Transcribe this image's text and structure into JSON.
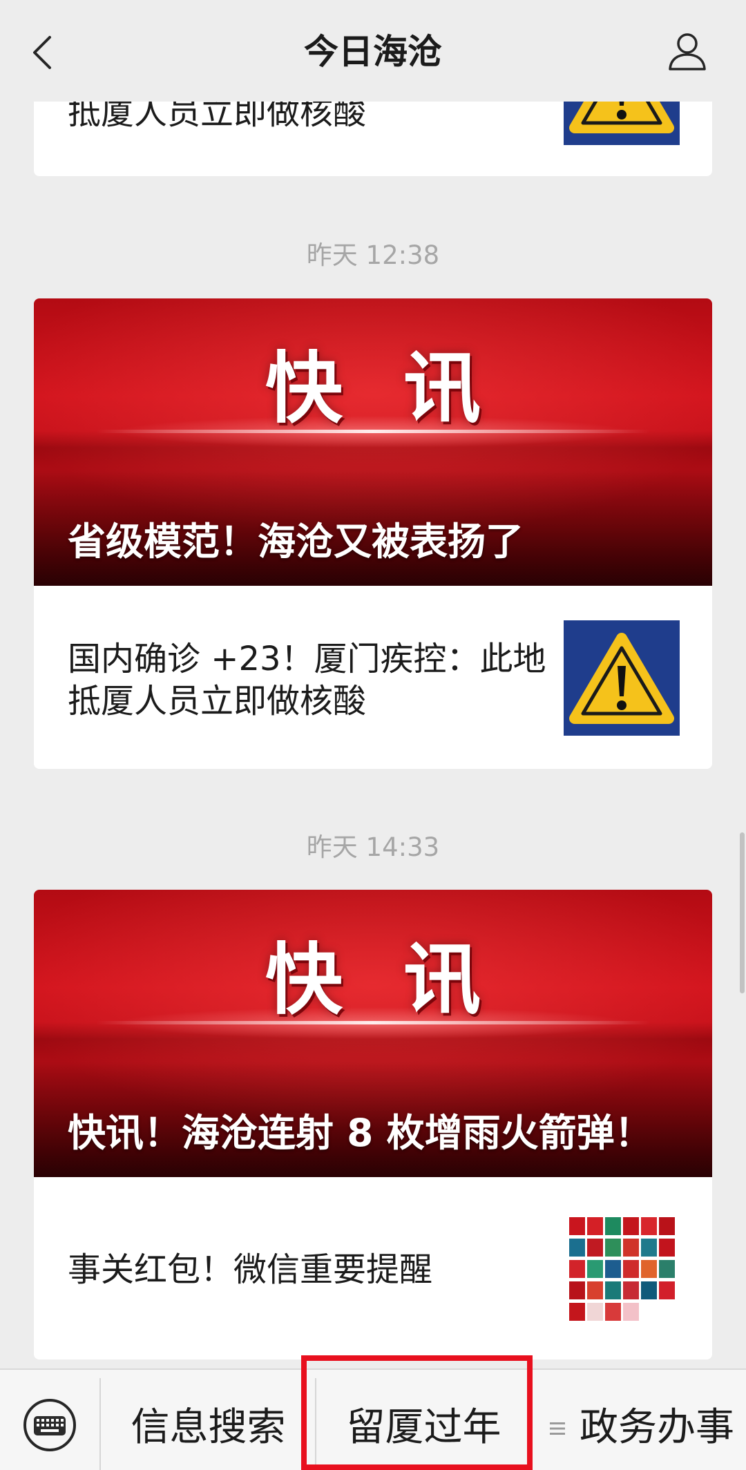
{
  "header": {
    "title": "今日海沧",
    "back_icon": "chevron-left-icon",
    "profile_icon": "person-icon"
  },
  "partial_card": {
    "title_line": "抵厦人员立即做核酸",
    "thumbnail": "warning-sign-icon"
  },
  "messages": [
    {
      "timestamp": "昨天 12:38",
      "banner": {
        "badge": "快讯",
        "title": "省级模范！海沧又被表扬了"
      },
      "item": {
        "lines": [
          "国内确诊 +23！厦门疾控：此地",
          "抵厦人员立即做核酸"
        ],
        "thumbnail": "warning-sign-icon"
      }
    },
    {
      "timestamp": "昨天 14:33",
      "banner": {
        "badge": "快讯",
        "title": "快讯！海沧连射 8 枚增雨火箭弹！"
      },
      "item": {
        "lines": [
          "事关红包！微信重要提醒"
        ],
        "thumbnail": "red-envelopes-image"
      }
    }
  ],
  "menu": {
    "keyboard_icon": "keyboard-icon",
    "items": [
      {
        "label": "信息搜索"
      },
      {
        "label": "留厦过年",
        "highlighted": true
      },
      {
        "label": "政务办事",
        "icon": "menu-lines-icon"
      }
    ]
  },
  "colors": {
    "background": "#ededed",
    "card": "#ffffff",
    "text": "#1b1b1b",
    "timestamp": "#a6a6a6",
    "highlight_border": "#e8101e",
    "warning_blue": "#1f3d8c",
    "warning_yellow": "#f5c21b",
    "menu_bar": "#f6f6f6"
  }
}
